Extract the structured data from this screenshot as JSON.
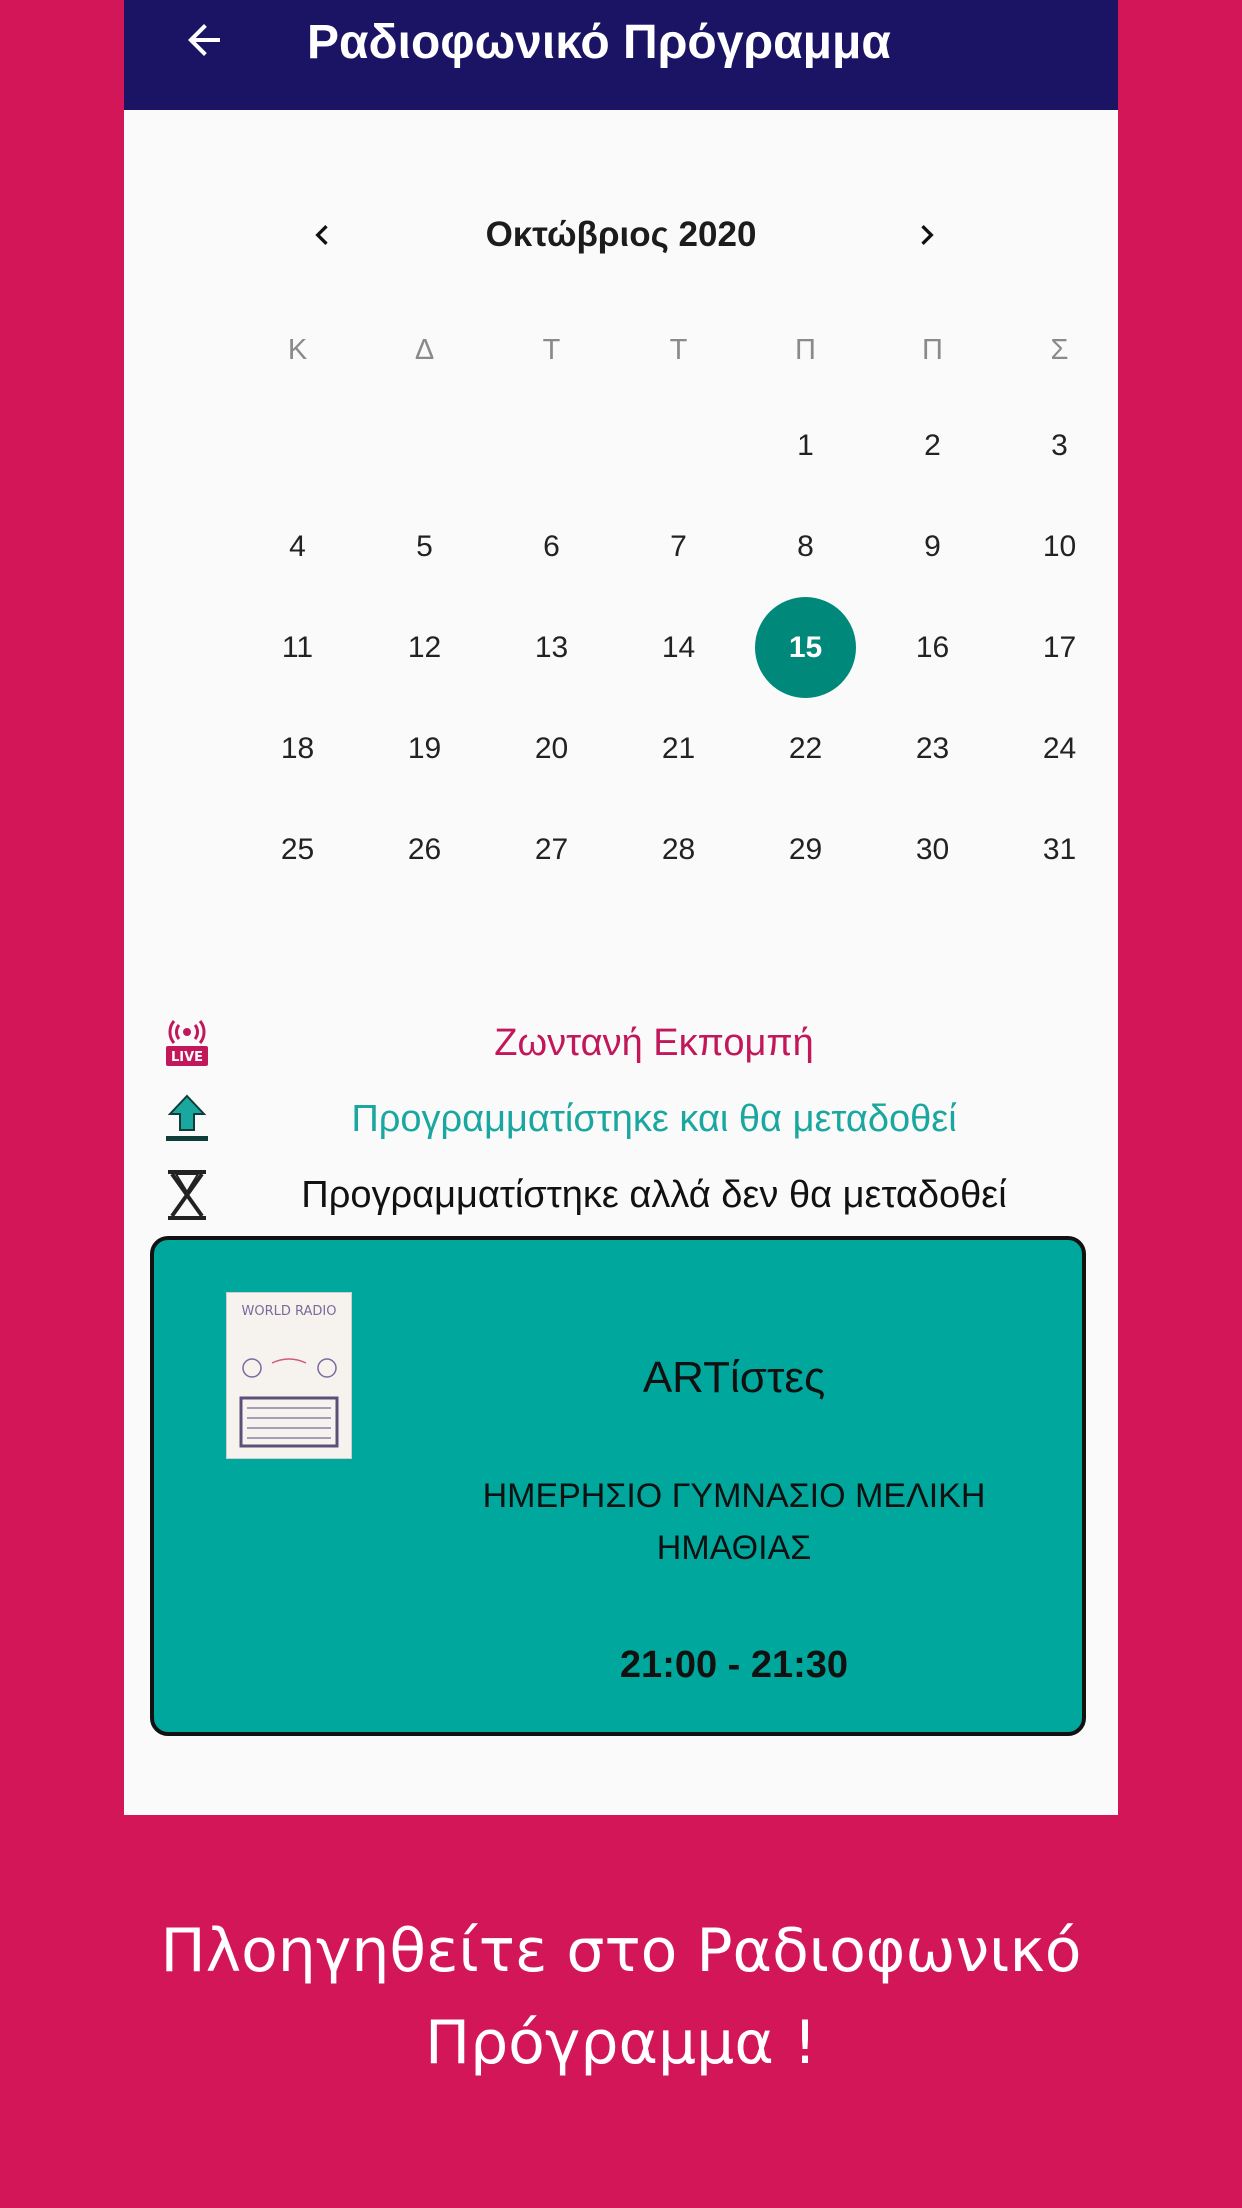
{
  "appbar": {
    "title": "Ραδιοφωνικό Πρόγραμμα",
    "back_icon": "arrow-left-icon"
  },
  "calendar": {
    "month_label": "Οκτώβριος 2020",
    "prev_icon": "chevron-left-icon",
    "next_icon": "chevron-right-icon",
    "weekdays": [
      "Κ",
      "Δ",
      "Τ",
      "Τ",
      "Π",
      "Π",
      "Σ"
    ],
    "days": [
      "1",
      "2",
      "3",
      "4",
      "5",
      "6",
      "7",
      "8",
      "9",
      "10",
      "11",
      "12",
      "13",
      "14",
      "15",
      "16",
      "17",
      "18",
      "19",
      "20",
      "21",
      "22",
      "23",
      "24",
      "25",
      "26",
      "27",
      "28",
      "29",
      "30",
      "31"
    ],
    "first_weekday_index": 4,
    "selected_day": "15",
    "selected_color": "#00897b"
  },
  "legend": [
    {
      "icon": "live-broadcast-icon",
      "label": "Ζωντανή Εκπομπή",
      "color": "#c2185b"
    },
    {
      "icon": "upload-arrow-icon",
      "label": "Προγραμματίστηκε και θα μεταδοθεί",
      "color": "#1aa7a0"
    },
    {
      "icon": "hourglass-cross-icon",
      "label": "Προγραμματίστηκε αλλά δεν θα μεταδοθεί",
      "color": "#111111"
    }
  ],
  "program": {
    "title": "ARTίστες",
    "school": "ΗΜΕΡΗΣΙΟ ΓΥΜΝΑΣΙΟ ΜΕΛΙΚΗ ΗΜΑΘΙΑΣ",
    "time": "21:00 - 21:30",
    "thumbnail_text": "WORLD RADIO",
    "card_color": "#00a79d"
  },
  "caption": "Πλοηγηθείτε στο Ραδιοφωνικό Πρόγραμμα !",
  "colors": {
    "background": "#d31657",
    "appbar": "#1b1464"
  }
}
